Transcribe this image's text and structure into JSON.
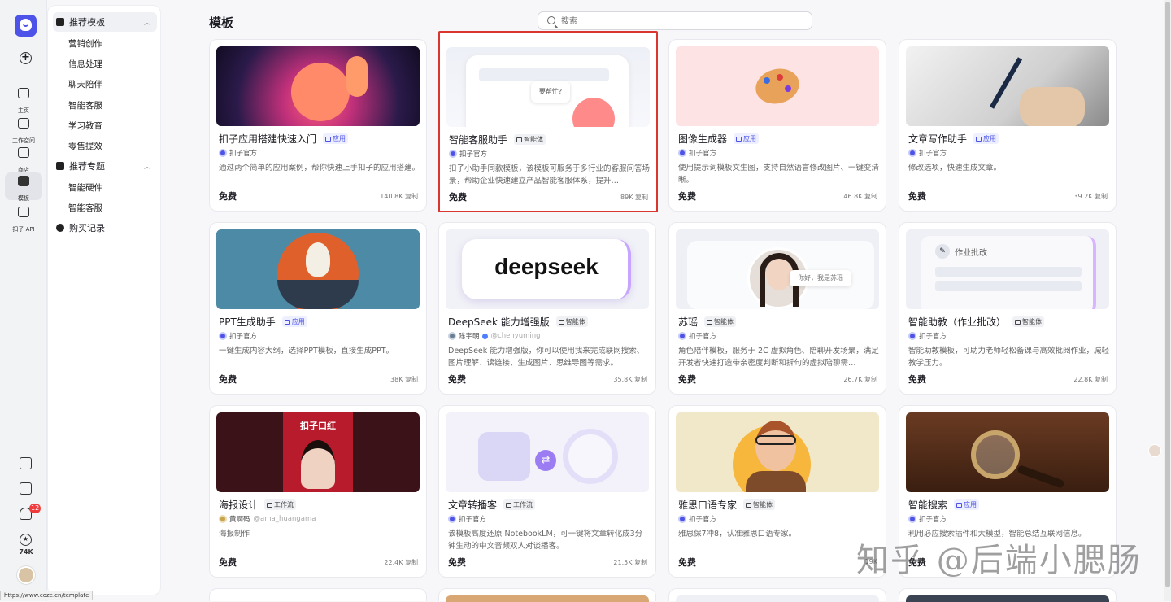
{
  "rail": {
    "items": [
      {
        "label": "主页"
      },
      {
        "label": "工作空间"
      },
      {
        "label": "商店"
      },
      {
        "label": "模板"
      },
      {
        "label": "扣子 API"
      }
    ],
    "notif_count": "12",
    "points": "74K"
  },
  "sidebar": {
    "sections": [
      {
        "label": "推荐模板",
        "items": [
          "营销创作",
          "信息处理",
          "聊天陪伴",
          "智能客服",
          "学习教育",
          "零售提效"
        ]
      },
      {
        "label": "推荐专题",
        "items": [
          "智能硬件",
          "智能客服"
        ]
      }
    ],
    "purchase": "购买记录"
  },
  "page": {
    "title": "模板",
    "search_placeholder": "搜索"
  },
  "cards": [
    {
      "title": "扣子应用搭建快速入门",
      "tag": "应用",
      "author": "扣子官方",
      "handle": "",
      "desc": "通过两个简单的应用案例，帮你快速上手扣子的应用搭建。",
      "price": "免费",
      "stats": "140.8K 复制",
      "thumb_text": ""
    },
    {
      "title": "智能客服助手",
      "tag": "智能体",
      "author": "扣子官方",
      "handle": "",
      "desc": "扣子小助手同款模板，该模板可服务于多行业的客服问答场景，帮助企业快速建立产品智能客服体系，提升…",
      "price": "免费",
      "stats": "89K 复制",
      "thumb_text": "要帮忙?"
    },
    {
      "title": "图像生成器",
      "tag": "应用",
      "author": "扣子官方",
      "handle": "",
      "desc": "使用提示词模板文生图，支持自然语言修改图片、一键变清晰。",
      "price": "免费",
      "stats": "46.8K 复制",
      "thumb_text": ""
    },
    {
      "title": "文章写作助手",
      "tag": "应用",
      "author": "扣子官方",
      "handle": "",
      "desc": "修改选项，快速生成文章。",
      "price": "免费",
      "stats": "39.2K 复制",
      "thumb_text": ""
    },
    {
      "title": "PPT生成助手",
      "tag": "应用",
      "author": "扣子官方",
      "handle": "",
      "desc": "一键生成内容大纲，选择PPT模板，直接生成PPT。",
      "price": "免费",
      "stats": "38K 复制",
      "thumb_text": ""
    },
    {
      "title": "DeepSeek 能力增强版",
      "tag": "智能体",
      "author": "陈宇明",
      "handle": "@chenyuming",
      "desc": "DeepSeek 能力增强版，你可以使用我来完成联网搜索、图片理解、读链接、生成图片、思维导图等需求。",
      "price": "免费",
      "stats": "35.8K 复制",
      "thumb_text": "deepseek"
    },
    {
      "title": "苏瑶",
      "tag": "智能体",
      "author": "扣子官方",
      "handle": "",
      "desc": "角色陪伴模板，服务于 2C 虚拟角色、陪聊开发场景，满足开发者快速打造带亲密度判断和拆句的虚拟陪聊需…",
      "price": "免费",
      "stats": "26.7K 复制",
      "thumb_text": "你好，我是苏瑶"
    },
    {
      "title": "智能助教（作业批改）",
      "tag": "智能体",
      "author": "扣子官方",
      "handle": "",
      "desc": "智能助教模板，可助力老师轻松备课与高效批阅作业，减轻教学压力。",
      "price": "免费",
      "stats": "22.8K 复制",
      "thumb_text": "作业批改"
    },
    {
      "title": "海报设计",
      "tag": "工作流",
      "author": "黄啊码",
      "handle": "@ama_huangama",
      "desc": "海报制作",
      "price": "免费",
      "stats": "22.4K 复制",
      "thumb_text": "扣子口红"
    },
    {
      "title": "文章转播客",
      "tag": "工作流",
      "author": "扣子官方",
      "handle": "",
      "desc": "该模板高度还原 NotebookLM，可一键将文章转化成3分钟生动的中文音频双人对谈播客。",
      "price": "免费",
      "stats": "21.5K 复制",
      "thumb_text": ""
    },
    {
      "title": "雅思口语专家",
      "tag": "智能体",
      "author": "扣子官方",
      "handle": "",
      "desc": "雅思保7冲8，认准雅思口语专家。",
      "price": "免费",
      "stats": "19K",
      "thumb_text": ""
    },
    {
      "title": "智能搜索",
      "tag": "应用",
      "author": "扣子官方",
      "handle": "",
      "desc": "利用必应搜索插件和大模型，智能总结互联网信息。",
      "price": "免费",
      "stats": "",
      "thumb_text": ""
    }
  ],
  "watermark": "知乎 @后端小腮肠",
  "status_url": "https://www.coze.cn/template"
}
